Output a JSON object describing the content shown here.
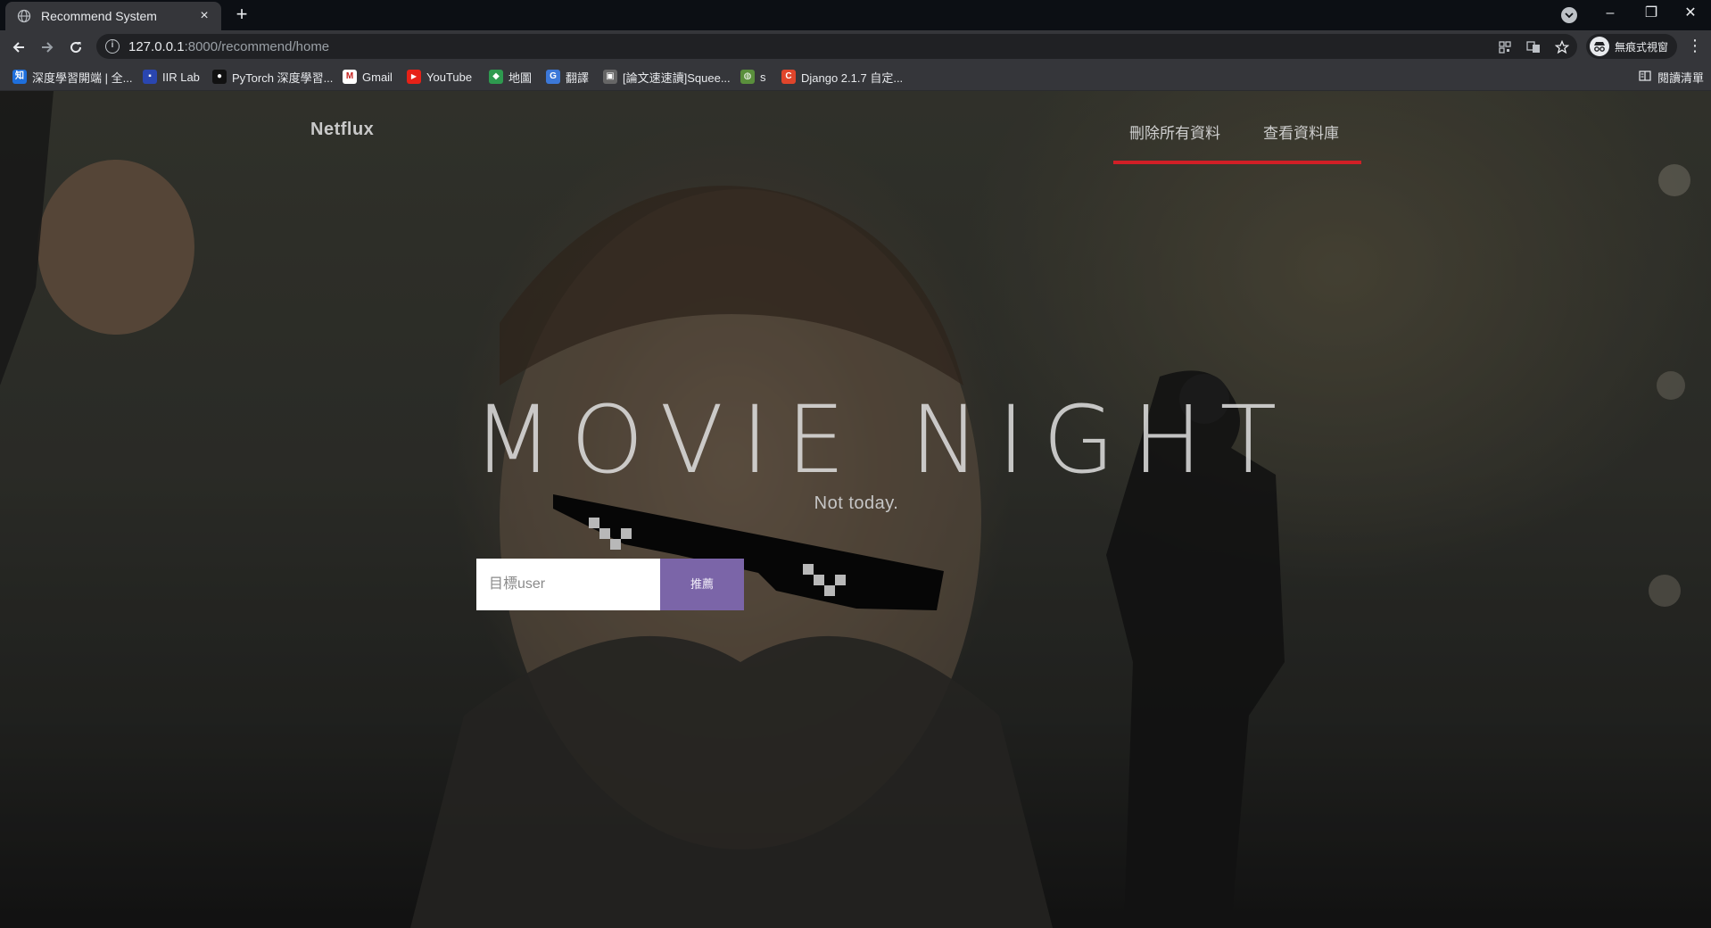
{
  "browser": {
    "tab_title": "Recommend System",
    "tab_close": "×",
    "new_tab": "+",
    "window_controls": [
      "–",
      "❐",
      "✕"
    ],
    "url_host": "127.0.0.1",
    "url_path": ":8000/recommend/home",
    "profile_label": "無痕式視窗",
    "reading_list": "閱讀清單"
  },
  "bookmarks": [
    {
      "label": "深度學習開端 | 全...",
      "icon": "知",
      "color": "#1e6fdc"
    },
    {
      "label": "IIR Lab",
      "icon": "▪",
      "color": "#2a46b0"
    },
    {
      "label": "PyTorch 深度學習...",
      "icon": "●",
      "color": "#111111"
    },
    {
      "label": "Gmail",
      "icon": "M",
      "color": "#c5221f"
    },
    {
      "label": "YouTube",
      "icon": "▶",
      "color": "#e62117"
    },
    {
      "label": "地圖",
      "icon": "◆",
      "color": "#2e9a4f"
    },
    {
      "label": "翻譯",
      "icon": "G",
      "color": "#3c78d8"
    },
    {
      "label": "[論文速速讀]Squee...",
      "icon": "▣",
      "color": "#666666"
    },
    {
      "label": "s",
      "icon": "◍",
      "color": "#5a8f3c"
    },
    {
      "label": "Django 2.1.7 自定...",
      "icon": "C",
      "color": "#e0452b"
    }
  ],
  "site": {
    "brand": "Netflux",
    "nav": [
      "刪除所有資料",
      "查看資料庫"
    ],
    "accent_color": "#d11f26"
  },
  "hero": {
    "title": "MOVIE NIGHT",
    "subtitle": "Not today."
  },
  "search": {
    "placeholder": "目標user",
    "value": "",
    "button_label": "推薦",
    "button_color": "#7b65a8"
  }
}
